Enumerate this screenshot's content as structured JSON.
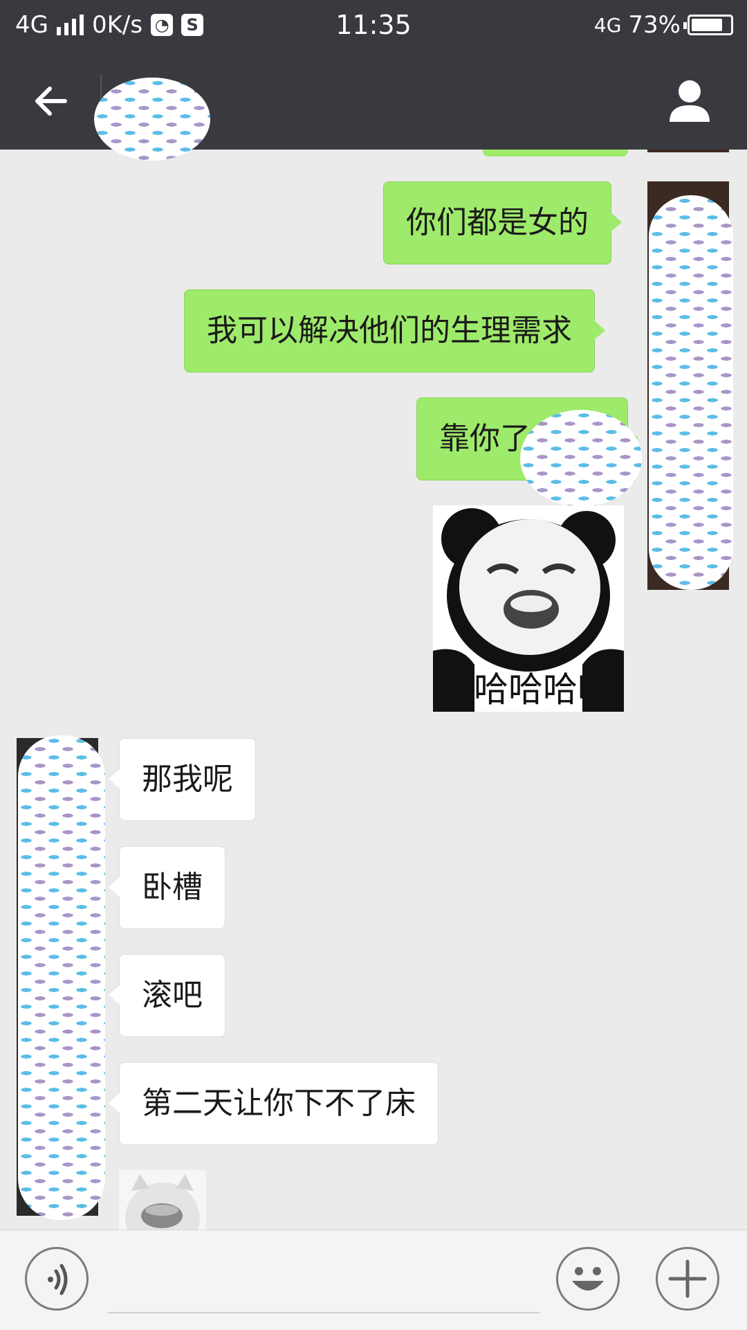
{
  "status_bar": {
    "network": "4G",
    "speed": "0K/s",
    "time": "11:35",
    "network_right": "4G",
    "battery": "73%"
  },
  "nav": {
    "back_icon": "arrow-left-icon",
    "profile_icon": "person-icon"
  },
  "messages": [
    {
      "side": "out",
      "text": "你们都是女的"
    },
    {
      "side": "out",
      "text": "我可以解决他们的生理需求"
    },
    {
      "side": "out",
      "text": "靠你了"
    },
    {
      "side": "out",
      "type": "sticker",
      "caption": "哈哈哈哈哈"
    },
    {
      "side": "in",
      "text": "那我呢"
    },
    {
      "side": "in",
      "text": "卧槽"
    },
    {
      "side": "in",
      "text": "滚吧"
    },
    {
      "side": "in",
      "text": "第二天让你下不了床"
    },
    {
      "side": "in",
      "type": "sticker"
    }
  ],
  "input_bar": {
    "voice_icon": "voice-icon",
    "emoji_icon": "smiley-icon",
    "more_icon": "plus-icon"
  },
  "colors": {
    "header": "#393a3f",
    "background": "#ebebeb",
    "outgoing_bubble": "#9eea6a",
    "incoming_bubble": "#ffffff"
  }
}
